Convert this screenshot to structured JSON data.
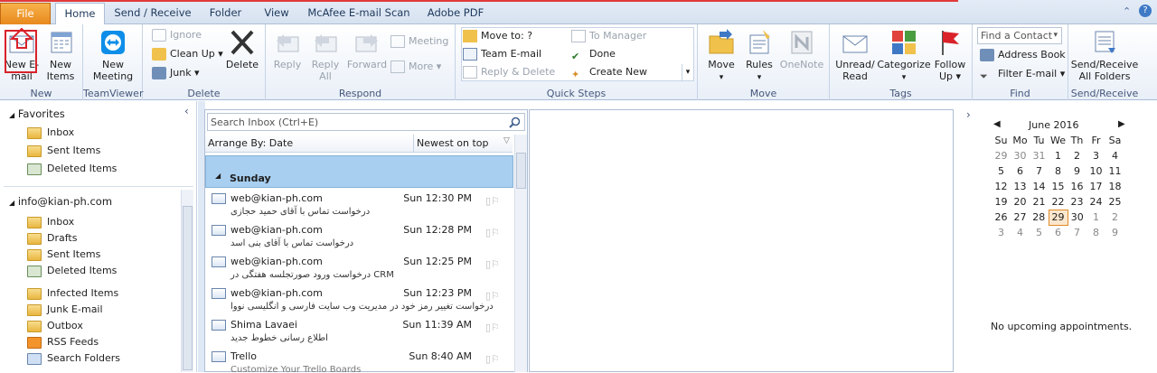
{
  "tabs": [
    "File",
    "Home",
    "Send / Receive",
    "Folder",
    "View",
    "McAfee E-mail Scan",
    "Adobe PDF"
  ],
  "ribbon": {
    "new": {
      "new_email": "New E-mail",
      "new_items": "New Items",
      "group": "New"
    },
    "teamviewer": {
      "new_meeting": "New Meeting",
      "group": "TeamViewer"
    },
    "delete": {
      "ignore": "Ignore",
      "cleanup": "Clean Up",
      "junk": "Junk",
      "delete": "Delete",
      "group": "Delete"
    },
    "respond": {
      "reply": "Reply",
      "reply_all": "Reply All",
      "forward": "Forward",
      "meeting": "Meeting",
      "more": "More",
      "group": "Respond"
    },
    "quicksteps": {
      "move_to": "Move to: ?",
      "team_email": "Team E-mail",
      "reply_delete": "Reply & Delete",
      "to_manager": "To Manager",
      "done": "Done",
      "create_new": "Create New",
      "group": "Quick Steps"
    },
    "move": {
      "move": "Move",
      "rules": "Rules",
      "onenote": "OneNote",
      "group": "Move"
    },
    "tags": {
      "unread": "Unread/ Read",
      "categorize": "Categorize",
      "followup": "Follow Up",
      "group": "Tags"
    },
    "find": {
      "find_contact": "Find a Contact",
      "address_book": "Address Book",
      "filter_email": "Filter E-mail",
      "group": "Find"
    },
    "sendreceive": {
      "btn": "Send/Receive All Folders",
      "group": "Send/Receive"
    }
  },
  "nav": {
    "favorites": "Favorites",
    "fav_items": [
      "Inbox",
      "Sent Items",
      "Deleted Items"
    ],
    "account": "info@kian-ph.com",
    "acc_items": [
      "Inbox",
      "Drafts",
      "Sent Items",
      "Deleted Items",
      "Infected Items",
      "Junk E-mail",
      "Outbox",
      "RSS Feeds",
      "Search Folders"
    ]
  },
  "list": {
    "search_placeholder": "Search Inbox (Ctrl+E)",
    "arrange": "Arrange By: Date",
    "order": "Newest on top",
    "group": "Sunday",
    "mails": [
      {
        "from": "web@kian-ph.com",
        "time": "Sun 12:30 PM",
        "subject": "درخواست تماس با آقای حمید حجازی"
      },
      {
        "from": "web@kian-ph.com",
        "time": "Sun 12:28 PM",
        "subject": "درخواست تماس با آقای بنی اسد"
      },
      {
        "from": "web@kian-ph.com",
        "time": "Sun 12:25 PM",
        "subject": "درخواست ورود صورتجلسه هفتگی در CRM"
      },
      {
        "from": "web@kian-ph.com",
        "time": "Sun 12:23 PM",
        "subject": "درخواست تغییر رمز خود در مدیریت وب سایت فارسی و انگلیسی نووا"
      },
      {
        "from": "Shima Lavaei",
        "time": "Sun 11:39 AM",
        "subject": "اطلاع رسانی خطوط جدید"
      },
      {
        "from": "Trello",
        "time": "Sun 8:40 AM",
        "subject": "Customize Your Trello Boards"
      }
    ]
  },
  "calendar": {
    "month": "June 2016",
    "days": [
      "Su",
      "Mo",
      "Tu",
      "We",
      "Th",
      "Fr",
      "Sa"
    ],
    "weeks": [
      [
        "29",
        "30",
        "31",
        "1",
        "2",
        "3",
        "4"
      ],
      [
        "5",
        "6",
        "7",
        "8",
        "9",
        "10",
        "11"
      ],
      [
        "12",
        "13",
        "14",
        "15",
        "16",
        "17",
        "18"
      ],
      [
        "19",
        "20",
        "21",
        "22",
        "23",
        "24",
        "25"
      ],
      [
        "26",
        "27",
        "28",
        "29",
        "30",
        "1",
        "2"
      ],
      [
        "3",
        "4",
        "5",
        "6",
        "7",
        "8",
        "9"
      ]
    ],
    "today": "29",
    "no_appointments": "No upcoming appointments."
  },
  "colors": {
    "file_tab": "#e8891e",
    "accent": "#1e395b",
    "annotation": "#d9222a"
  }
}
